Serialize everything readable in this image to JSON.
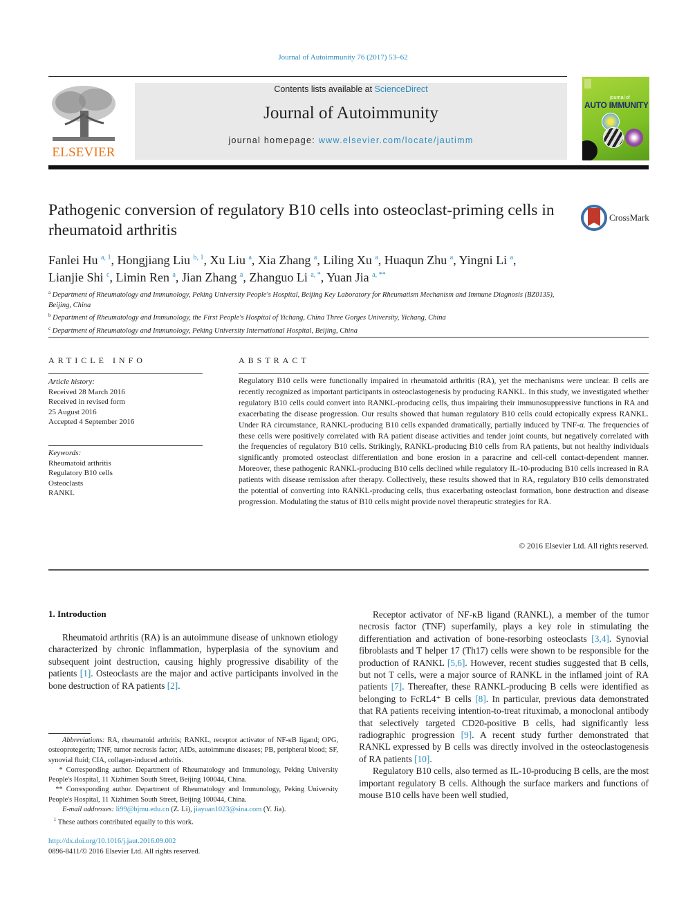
{
  "running_head": "Journal of Autoimmunity 76 (2017) 53–62",
  "header": {
    "publisher_logo_text": "ELSEVIER",
    "contents_prefix": "Contents lists available at ",
    "contents_link": "ScienceDirect",
    "journal_title": "Journal of Autoimmunity",
    "homepage_prefix": "journal homepage: ",
    "homepage_link": "www.elsevier.com/locate/jautimm",
    "cover_small": "journal of",
    "cover_title": "AUTO IMMUNITY"
  },
  "article": {
    "title": "Pathogenic conversion of regulatory B10 cells into osteoclast-priming cells in rheumatoid arthritis",
    "crossmark_label": "CrossMark",
    "authors": [
      {
        "name": "Fanlei Hu",
        "sup": "a, 1",
        "sep": ", "
      },
      {
        "name": "Hongjiang Liu",
        "sup": "b, 1",
        "sep": ", "
      },
      {
        "name": "Xu Liu",
        "sup": "a",
        "sep": ", "
      },
      {
        "name": "Xia Zhang",
        "sup": "a",
        "sep": ", "
      },
      {
        "name": "Liling Xu",
        "sup": "a",
        "sep": ", "
      },
      {
        "name": "Huaqun Zhu",
        "sup": "a",
        "sep": ", "
      },
      {
        "name": "Yingni Li",
        "sup": "a",
        "sep": ","
      },
      {
        "name": "Lianjie Shi",
        "sup": "c",
        "sep": ", "
      },
      {
        "name": "Limin Ren",
        "sup": "a",
        "sep": ", "
      },
      {
        "name": "Jian Zhang",
        "sup": "a",
        "sep": ", "
      },
      {
        "name": "Zhanguo Li",
        "sup": "a, *",
        "sep": ", "
      },
      {
        "name": "Yuan Jia",
        "sup": "a, **",
        "sep": ""
      }
    ],
    "affiliations": [
      {
        "mark": "a",
        "text": "Department of Rheumatology and Immunology, Peking University People's Hospital, Beijing Key Laboratory for Rheumatism Mechanism and Immune Diagnosis (BZ0135), Beijing, China"
      },
      {
        "mark": "b",
        "text": "Department of Rheumatology and Immunology, the First People's Hospital of Yichang, China Three Gorges University, Yichang, China"
      },
      {
        "mark": "c",
        "text": "Department of Rheumatology and Immunology, Peking University International Hospital, Beijing, China"
      }
    ]
  },
  "article_info": {
    "heading": "ARTICLE INFO",
    "history_label": "Article history:",
    "history": [
      "Received 28 March 2016",
      "Received in revised form",
      "25 August 2016",
      "Accepted 4 September 2016"
    ],
    "keywords_label": "Keywords:",
    "keywords": [
      "Rheumatoid arthritis",
      "Regulatory B10 cells",
      "Osteoclasts",
      "RANKL"
    ]
  },
  "abstract": {
    "heading": "ABSTRACT",
    "text": "Regulatory B10 cells were functionally impaired in rheumatoid arthritis (RA), yet the mechanisms were unclear. B cells are recently recognized as important participants in osteoclastogenesis by producing RANKL. In this study, we investigated whether regulatory B10 cells could convert into RANKL-producing cells, thus impairing their immunosuppressive functions in RA and exacerbating the disease progression. Our results showed that human regulatory B10 cells could ectopically express RANKL. Under RA circumstance, RANKL-producing B10 cells expanded dramatically, partially induced by TNF-α. The frequencies of these cells were positively correlated with RA patient disease activities and tender joint counts, but negatively correlated with the frequencies of regulatory B10 cells. Strikingly, RANKL-producing B10 cells from RA patients, but not healthy individuals significantly promoted osteoclast differentiation and bone erosion in a paracrine and cell-cell contact-dependent manner. Moreover, these pathogenic RANKL-producing B10 cells declined while regulatory IL-10-producing B10 cells increased in RA patients with disease remission after therapy. Collectively, these results showed that in RA, regulatory B10 cells demonstrated the potential of converting into RANKL-producing cells, thus exacerbating osteoclast formation, bone destruction and disease progression. Modulating the status of B10 cells might provide novel therapeutic strategies for RA.",
    "copyright": "© 2016 Elsevier Ltd. All rights reserved."
  },
  "introduction": {
    "heading": "1.  Introduction",
    "p1": [
      {
        "t": "Rheumatoid arthritis (RA) is an autoimmune disease of unknown etiology characterized by chronic inflammation, hyperplasia of the synovium and subsequent joint destruction, causing highly progressive disability of the patients "
      },
      {
        "ref": "[1]"
      },
      {
        "t": ". Osteoclasts are the major and active participants involved in the bone destruction of RA patients "
      },
      {
        "ref": "[2]"
      },
      {
        "t": "."
      }
    ],
    "p2": [
      {
        "t": "Receptor activator of NF-κB ligand (RANKL), a member of the tumor necrosis factor (TNF) superfamily, plays a key role in stimulating the differentiation and activation of bone-resorbing osteoclasts "
      },
      {
        "ref": "[3,4]"
      },
      {
        "t": ". Synovial fibroblasts and T helper 17 (Th17) cells were shown to be responsible for the production of RANKL "
      },
      {
        "ref": "[5,6]"
      },
      {
        "t": ". However, recent studies suggested that B cells, but not T cells, were a major source of RANKL in the inflamed joint of RA patients "
      },
      {
        "ref": "[7]"
      },
      {
        "t": ". Thereafter, these RANKL-producing B cells were identified as belonging to FcRL4⁺ B cells "
      },
      {
        "ref": "[8]"
      },
      {
        "t": ". In particular, previous data demonstrated that RA patients receiving intention-to-treat rituximab, a monoclonal antibody that selectively targeted CD20-positive B cells, had significantly less radiographic progression "
      },
      {
        "ref": "[9]"
      },
      {
        "t": ". A recent study further demonstrated that RANKL expressed by B cells was directly involved in the osteoclastogenesis of RA patients "
      },
      {
        "ref": "[10]"
      },
      {
        "t": "."
      }
    ],
    "p3": [
      {
        "t": "Regulatory B10 cells, also termed as IL-10-producing B cells, are the most important regulatory B cells. Although the surface markers and functions of mouse B10 cells have been well studied,"
      }
    ]
  },
  "footnotes": {
    "abbrev_label": "Abbreviations:",
    "abbrev_text": " RA, rheumatoid arthritis; RANKL, receptor activator of NF-κB ligand; OPG, osteoprotegerin; TNF, tumor necrosis factor; AIDs, autoimmune diseases; PB, peripheral blood; SF, synovial fluid; CIA, collagen-induced arthritis.",
    "corr1_mark": "*",
    "corr1_text": " Corresponding author. Department of Rheumatology and Immunology, Peking University People's Hospital, 11 Xizhimen South Street, Beijing 100044, China.",
    "corr2_mark": "**",
    "corr2_text": " Corresponding author. Department of Rheumatology and Immunology, Peking University People's Hospital, 11 Xizhimen South Street, Beijing 100044, China.",
    "email_label": "E-mail addresses:",
    "email1": "li99@bjmu.edu.cn",
    "email1_who": " (Z. Li), ",
    "email2": "jiayuan1023@sina.com",
    "email2_who": " (Y. Jia).",
    "equal_mark": "1",
    "equal_text": " These authors contributed equally to this work."
  },
  "doi": "http://dx.doi.org/10.1016/j.jaut.2016.09.002",
  "issn_line": "0896-8411/© 2016 Elsevier Ltd. All rights reserved.",
  "colors": {
    "link": "#2a8cbf",
    "elsevier_orange": "#e8771e",
    "banner_bg": "#e9e9e9",
    "cover_green": "#8cc63f"
  }
}
